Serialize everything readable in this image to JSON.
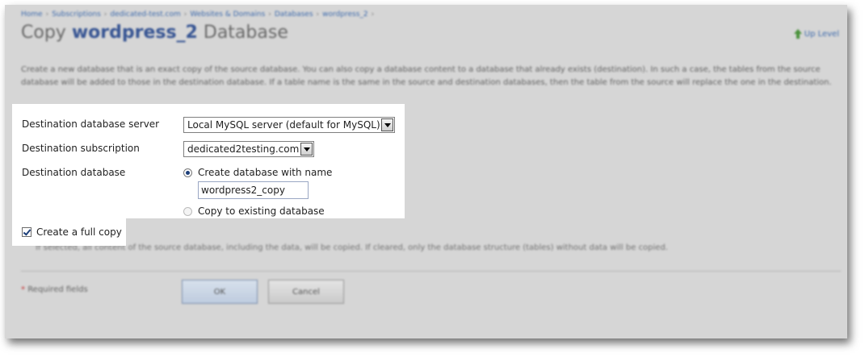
{
  "breadcrumb": {
    "items": [
      "Home",
      "Subscriptions",
      "dedicated-test.com",
      "Websites & Domains",
      "Databases",
      "wordpress_2"
    ],
    "separator": "›"
  },
  "title": {
    "prefix": "Copy",
    "db_name": "wordpress_2",
    "suffix": "Database"
  },
  "up_level": {
    "label": "Up Level",
    "icon": "up-arrow-icon"
  },
  "intro": "Create a new database that is an exact copy of the source database. You can also copy a database content to a database that already exists (destination). In such a case, the tables from the source database will be added to those in the destination database. If a table name is the same in the source and destination databases, then the table from the source will replace the one in the destination.",
  "form": {
    "server": {
      "label": "Destination database server",
      "value": "Local MySQL server (default for MySQL)"
    },
    "subscription": {
      "label": "Destination subscription",
      "value": "dedicated2testing.com"
    },
    "database": {
      "label": "Destination database",
      "option_create": "Create database with name",
      "name_value": "wordpress2_copy",
      "option_existing": "Copy to existing database"
    },
    "full_copy": {
      "label": "Create a full copy",
      "checked": true,
      "hint": "If selected, all content of the source database, including the data, will be copied. If cleared, only the database structure (tables) without data will be copied."
    }
  },
  "footer": {
    "required_star": "*",
    "required_label": "Required fields",
    "ok_label": "OK",
    "cancel_label": "Cancel"
  },
  "colors": {
    "link": "#2c5ea8",
    "title_accent": "#26478c",
    "panel_background": "#d6d6d6",
    "highlight_background": "#ffffff"
  }
}
